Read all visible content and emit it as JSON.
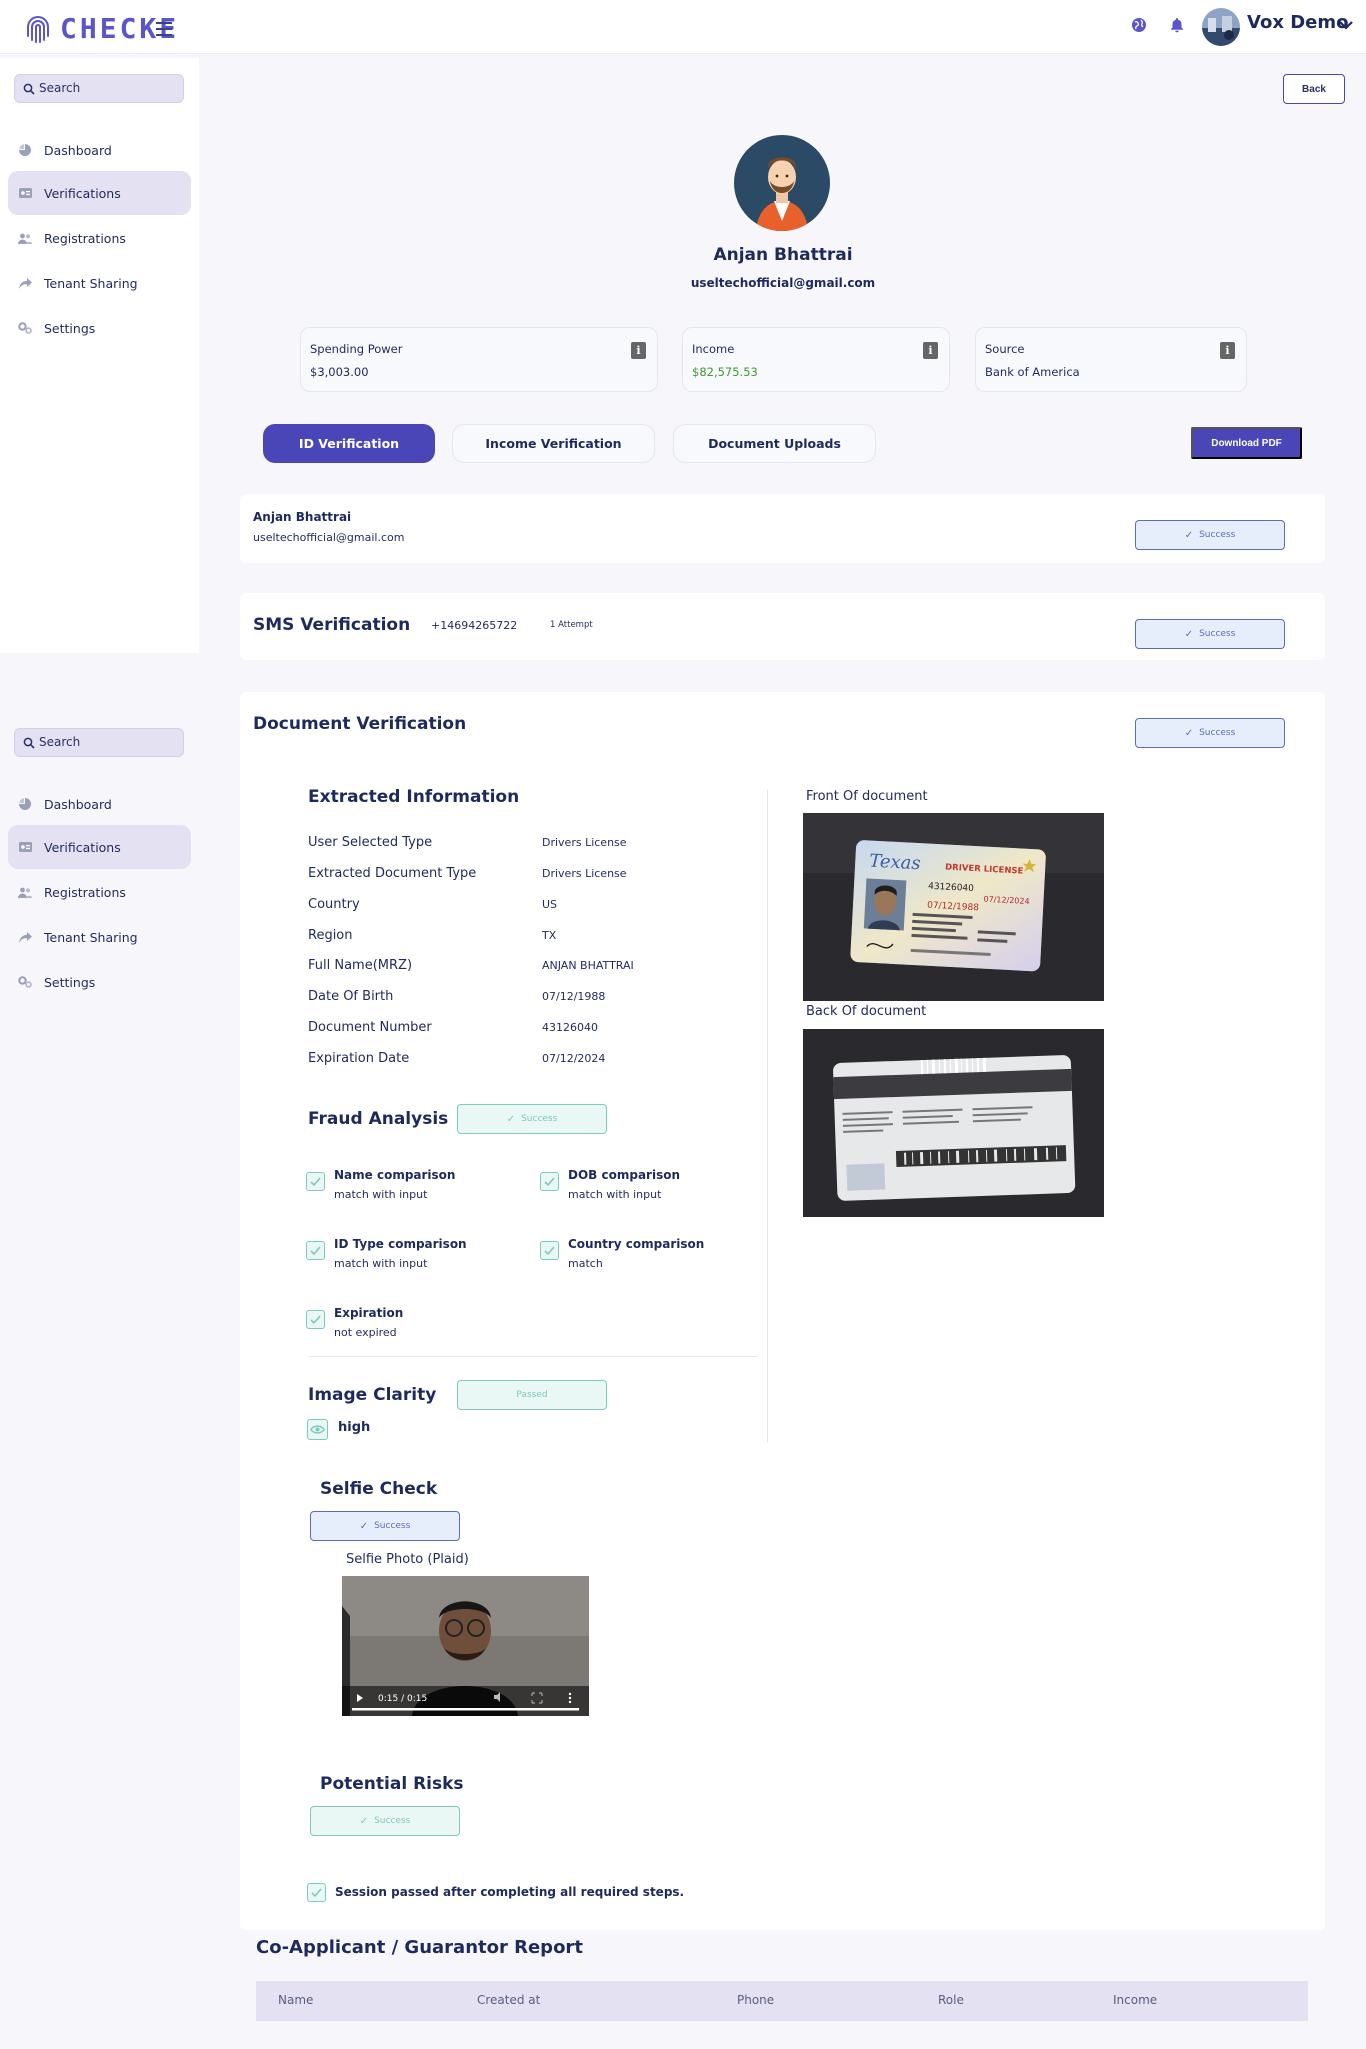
{
  "header": {
    "logo_text": "CHECKE",
    "user_name": "Vox Demo"
  },
  "sidebar": {
    "search_label": "Search",
    "items": [
      {
        "label": "Dashboard",
        "icon": "pie-chart-icon",
        "active": false
      },
      {
        "label": "Verifications",
        "icon": "id-card-icon",
        "active": true
      },
      {
        "label": "Registrations",
        "icon": "users-icon",
        "active": false
      },
      {
        "label": "Tenant Sharing",
        "icon": "share-icon",
        "active": false
      },
      {
        "label": "Settings",
        "icon": "gears-icon",
        "active": false
      }
    ]
  },
  "back_label": "Back",
  "profile": {
    "name": "Anjan Bhattrai",
    "email": "useltechofficial@gmail.com"
  },
  "stats": [
    {
      "label": "Spending Power",
      "value": "$3,003.00"
    },
    {
      "label": "Income",
      "value": "$82,575.53"
    },
    {
      "label": "Source",
      "value": "Bank of America"
    }
  ],
  "tabs": [
    {
      "label": "ID Verification",
      "active": true
    },
    {
      "label": "Income Verification",
      "active": false
    },
    {
      "label": "Document Uploads",
      "active": false
    }
  ],
  "download_label": "Download PDF",
  "identity_card": {
    "name": "Anjan Bhattrai",
    "email": "useltechofficial@gmail.com",
    "status": "Success"
  },
  "sms": {
    "title": "SMS Verification",
    "phone": "+14694265722",
    "attempts": "1 Attempt",
    "status": "Success"
  },
  "document": {
    "title": "Document Verification",
    "status": "Success",
    "extracted_title": "Extracted Information",
    "fields": [
      {
        "label": "User Selected Type",
        "value": "Drivers License"
      },
      {
        "label": "Extracted Document Type",
        "value": "Drivers License"
      },
      {
        "label": "Country",
        "value": "US"
      },
      {
        "label": "Region",
        "value": "TX"
      },
      {
        "label": "Full Name(MRZ)",
        "value": "ANJAN BHATTRAI"
      },
      {
        "label": "Date Of Birth",
        "value": "07/12/1988"
      },
      {
        "label": "Document Number",
        "value": "43126040"
      },
      {
        "label": "Expiration Date",
        "value": "07/12/2024"
      }
    ],
    "fraud_title": "Fraud Analysis",
    "fraud_status": "Success",
    "checks": [
      {
        "title": "Name comparison",
        "sub": "match with input"
      },
      {
        "title": "DOB comparison",
        "sub": "match with input"
      },
      {
        "title": "ID Type comparison",
        "sub": "match with input"
      },
      {
        "title": "Country comparison",
        "sub": "match"
      },
      {
        "title": "Expiration",
        "sub": "not expired"
      }
    ],
    "clarity_title": "Image Clarity",
    "clarity_status": "Passed",
    "clarity_value": "high",
    "front_label": "Front Of document",
    "back_label": "Back Of document",
    "license_state": "Texas",
    "license_type": "DRIVER LICENSE",
    "license_number": "43126040",
    "license_dob": "07/12/1988",
    "license_exp": "07/12/2024"
  },
  "selfie": {
    "title": "Selfie Check",
    "status": "Success",
    "photo_label": "Selfie Photo (Plaid)",
    "video_time": "0:15 / 0:15"
  },
  "risks": {
    "title": "Potential Risks",
    "status": "Success",
    "session_text": "Session passed after completing all required steps."
  },
  "co_applicant": {
    "title": "Co-Applicant / Guarantor Report",
    "columns": [
      "Name",
      "Created at",
      "Phone",
      "Role",
      "Income"
    ]
  },
  "colors": {
    "primary": "#4a46b8",
    "navy": "#1f2a5c",
    "success_teal": "#7cc9bd",
    "income_green": "#3f9a2f"
  }
}
